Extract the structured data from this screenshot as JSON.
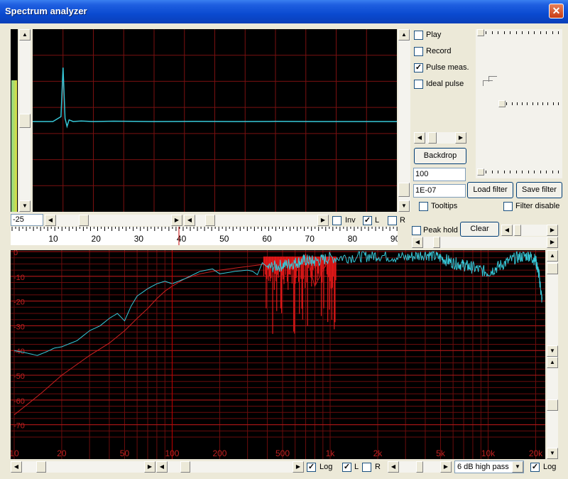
{
  "window": {
    "title": "Spectrum analyzer"
  },
  "checkboxes": {
    "play": {
      "label": "Play",
      "checked": false
    },
    "record": {
      "label": "Record",
      "checked": false
    },
    "pulse_meas": {
      "label": "Pulse meas.",
      "checked": true
    },
    "ideal_pulse": {
      "label": "Ideal pulse",
      "checked": false
    },
    "tooltips": {
      "label": "Tooltips",
      "checked": false
    },
    "filter_disable": {
      "label": "Filter disable",
      "checked": false
    },
    "peak_hold": {
      "label": "Peak hold",
      "checked": false
    },
    "inv": {
      "label": "Inv",
      "checked": false
    },
    "upper_l": {
      "label": "L",
      "checked": true
    },
    "upper_r": {
      "label": "R",
      "checked": false
    },
    "lower_log": {
      "label": "Log",
      "checked": true
    },
    "lower_l": {
      "label": "L",
      "checked": true
    },
    "lower_r": {
      "label": "R",
      "checked": false
    },
    "right_log": {
      "label": "Log",
      "checked": true
    }
  },
  "buttons": {
    "backdrop": "Backdrop",
    "load_filter": "Load filter",
    "save_filter": "Save filter",
    "clear": "Clear"
  },
  "inputs": {
    "value_100": "100",
    "value_1e07": "1E-07",
    "offset": "-25"
  },
  "filter_select": {
    "selected": "6 dB high pass"
  },
  "time_axis": {
    "ticks": [
      "10",
      "20",
      "30",
      "40",
      "50",
      "60",
      "70",
      "80",
      "90"
    ]
  },
  "level_meter": {
    "level": 0.72
  },
  "chart_data": [
    {
      "type": "line",
      "description_view": "time-domain impulse",
      "series": [
        {
          "color": "#37c8d8",
          "x": [
            0,
            5,
            7,
            7.5,
            8,
            8.5,
            9,
            10,
            12,
            15,
            20,
            30,
            40,
            50,
            60,
            70,
            80,
            90
          ],
          "values": [
            0,
            0,
            0.3,
            3.3,
            0.2,
            -0.3,
            0.1,
            0,
            0.03,
            0,
            0.02,
            0,
            0.01,
            0,
            0.01,
            0,
            0,
            0
          ]
        }
      ],
      "xlim": [
        0,
        90
      ]
    },
    {
      "type": "line",
      "x_scale": "log",
      "xticks": [
        "10",
        "20",
        "50",
        "100",
        "200",
        "500",
        "1k",
        "2k",
        "5k",
        "10k",
        "20k"
      ],
      "yticks": [
        "0",
        "-10",
        "-20",
        "-30",
        "-40",
        "-50",
        "-60",
        "-70"
      ],
      "ylim": [
        -77,
        0
      ],
      "series": [
        {
          "color": "#37c8d8",
          "x": [
            10,
            12,
            14,
            16,
            18,
            20,
            25,
            30,
            35,
            40,
            45,
            50,
            55,
            60,
            70,
            80,
            90,
            100,
            120,
            150,
            180,
            200,
            250,
            300,
            400,
            500,
            600,
            700,
            800,
            1000,
            1500,
            2000,
            3000,
            4000,
            5000,
            6000,
            7000,
            8000,
            10000,
            12000,
            15000,
            18000,
            20000,
            21000,
            22000
          ],
          "values": [
            -40,
            -41,
            -42,
            -40.5,
            -39,
            -38.5,
            -36,
            -32,
            -30,
            -27,
            -25,
            -28,
            -22,
            -18,
            -15,
            -13,
            -12,
            -13,
            -11,
            -8,
            -7,
            -9,
            -8,
            -7.5,
            -6,
            -5,
            -4,
            -3,
            -3.5,
            -2,
            -1.5,
            -1,
            -2,
            -0.5,
            -2,
            -4,
            -5,
            -6,
            -8,
            -5,
            -2,
            -1,
            -3,
            -9,
            -20
          ]
        },
        {
          "color": "#cc2020",
          "x": [
            10,
            12,
            15,
            20,
            30,
            40,
            50,
            60,
            70,
            80,
            90,
            100,
            120,
            150,
            200,
            300,
            400,
            500,
            600,
            700,
            800,
            1000
          ],
          "values": [
            -66,
            -62,
            -57,
            -50,
            -42,
            -37,
            -32,
            -27,
            -23,
            -19,
            -16,
            -14,
            -11,
            -9,
            -7.5,
            -6,
            -5,
            -3,
            -8,
            -1,
            -14,
            -2
          ]
        }
      ]
    }
  ]
}
